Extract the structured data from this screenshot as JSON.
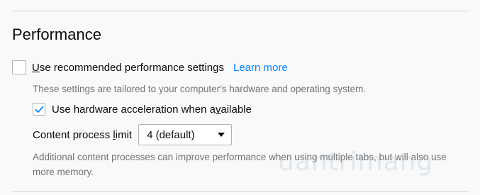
{
  "section": {
    "title": "Performance"
  },
  "recommended": {
    "label_first": "U",
    "label_rest": "se recommended performance settings",
    "checked": false,
    "learn_more": "Learn more",
    "description": "These settings are tailored to your computer's hardware and operating system."
  },
  "hardware_accel": {
    "label_start": "Use hardware acceleration when a",
    "label_underlined": "v",
    "label_end": "ailable",
    "checked": true
  },
  "content_process": {
    "label_start": "Content process ",
    "label_underlined": "l",
    "label_end": "imit",
    "selected": "4 (default)",
    "description": "Additional content processes can improve performance when using multiple tabs, but will also use more memory."
  },
  "watermark": {
    "text": "uantrimang"
  },
  "colors": {
    "accent": "#0a84ff",
    "background": "#f9f9fa",
    "muted_text": "#737373"
  }
}
